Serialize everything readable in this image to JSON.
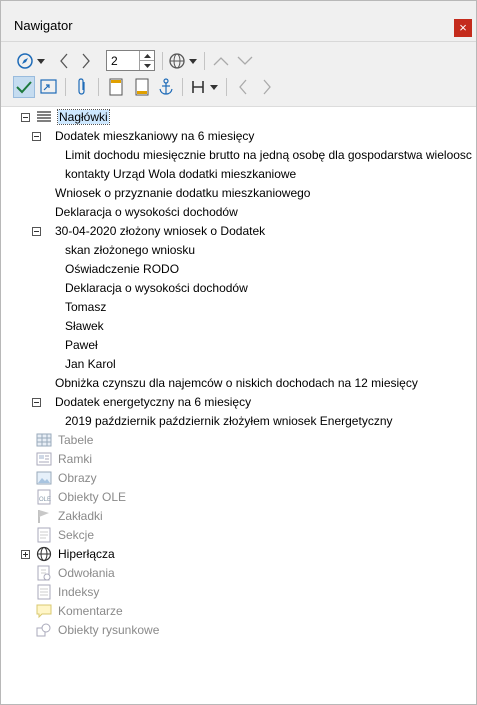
{
  "window": {
    "title": "Nawigator",
    "close_label": "×"
  },
  "toolbar": {
    "level_value": "2",
    "icons": [
      "navigator-toggle-icon",
      "previous-icon",
      "next-icon",
      "drag-mode-icon",
      "dropdown-icon",
      "promote-chapter-icon",
      "demote-chapter-icon",
      "content-view-icon",
      "set-reminder-icon",
      "attachment-icon",
      "header-icon",
      "footer-icon",
      "anchor-icon",
      "heading-levels-icon",
      "dropdown-icon",
      "prev-arrow-icon",
      "next-arrow-icon"
    ]
  },
  "tree": {
    "root": "Nagłówki",
    "headings": [
      {
        "label": "Dodatek mieszkaniowy na 6 miesięcy",
        "level": 1,
        "expander": "minus"
      },
      {
        "label": "Limit dochodu miesięcznie brutto na jedną osobę dla gospodarstwa wieloosc",
        "level": 2
      },
      {
        "label": "kontakty Urząd Wola dodatki mieszkaniowe",
        "level": 2
      },
      {
        "label": "Wniosek o przyznanie dodatku mieszkaniowego",
        "level": 1
      },
      {
        "label": "Deklaracja o wysokości dochodów",
        "level": 1
      },
      {
        "label": "30-04-2020 złożony wniosek o Dodatek",
        "level": 1,
        "expander": "minus"
      },
      {
        "label": "skan złożonego wniosku",
        "level": 2
      },
      {
        "label": "Oświadczenie RODO",
        "level": 2
      },
      {
        "label": "Deklaracja o wysokości dochodów",
        "level": 2
      },
      {
        "label": "Tomasz",
        "level": 2
      },
      {
        "label": "Sławek",
        "level": 2
      },
      {
        "label": "Paweł",
        "level": 2
      },
      {
        "label": "Jan Karol",
        "level": 2
      },
      {
        "label": "Obniżka czynszu dla najemców o niskich dochodach na 12 miesięcy",
        "level": 1
      },
      {
        "label": "Dodatek energetyczny na 6 miesięcy",
        "level": 1,
        "expander": "minus"
      },
      {
        "label": "2019 październik październik złożyłem wniosek Energetyczny",
        "level": 2
      }
    ],
    "categories": [
      {
        "label": "Tabele",
        "icon": "table-icon",
        "enabled": false
      },
      {
        "label": "Ramki",
        "icon": "frame-icon",
        "enabled": false
      },
      {
        "label": "Obrazy",
        "icon": "image-icon",
        "enabled": false
      },
      {
        "label": "Obiekty OLE",
        "icon": "ole-object-icon",
        "enabled": false
      },
      {
        "label": "Zakładki",
        "icon": "bookmark-icon",
        "enabled": false
      },
      {
        "label": "Sekcje",
        "icon": "section-icon",
        "enabled": false
      },
      {
        "label": "Hiperłącza",
        "icon": "globe-icon",
        "enabled": true,
        "expander": "plus"
      },
      {
        "label": "Odwołania",
        "icon": "reference-icon",
        "enabled": false
      },
      {
        "label": "Indeksy",
        "icon": "index-icon",
        "enabled": false
      },
      {
        "label": "Komentarze",
        "icon": "comment-icon",
        "enabled": false
      },
      {
        "label": "Obiekty rysunkowe",
        "icon": "drawing-object-icon",
        "enabled": false
      }
    ]
  },
  "colors": {
    "close": "#c42b1c",
    "selection": "#cde8ff",
    "active_toggle": "#c5dcf0",
    "disabled_text": "#8a8a8a"
  }
}
